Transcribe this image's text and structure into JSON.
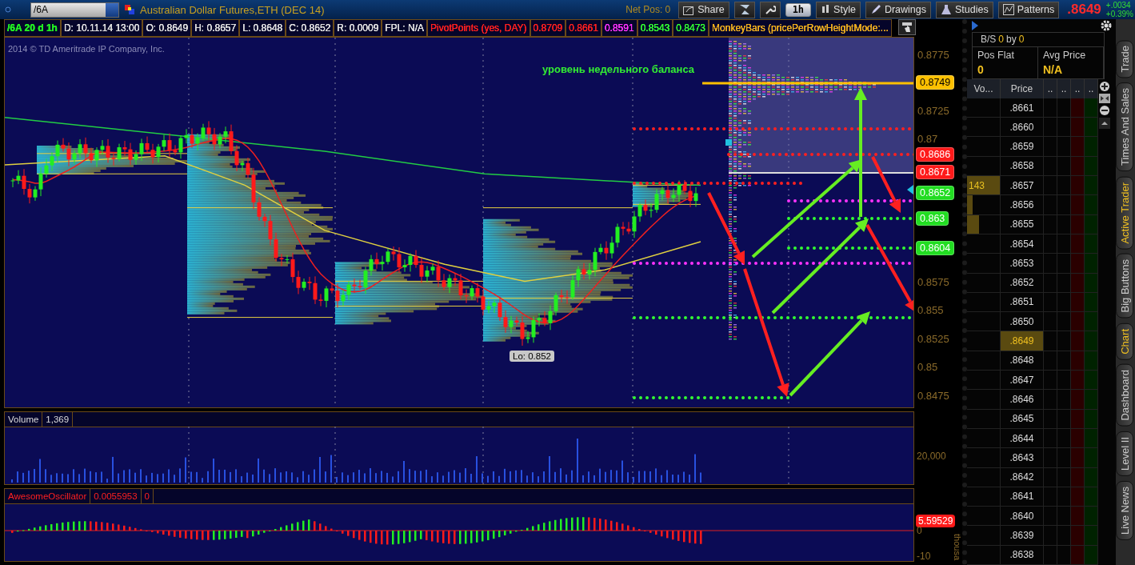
{
  "toolbar": {
    "symbol": "/6A",
    "title": "Australian Dollar Futures,ETH (DEC 14)",
    "net_position": "Net Pos: 0",
    "share": "Share",
    "period": "1h",
    "tools": [
      "Style",
      "Drawings",
      "Studies",
      "Patterns"
    ],
    "last": ".8649",
    "change": "+.0034",
    "change_pct": "+0.39%"
  },
  "info_bar": {
    "symbol": "/6A 20 d 1h",
    "fields": [
      "D: 10.11.14 13:00",
      "O: 0.8649",
      "H: 0.8657",
      "L: 0.8648",
      "C: 0.8652",
      "R: 0.0009",
      "FPL: N/A"
    ],
    "study": "PivotPoints (yes, DAY)",
    "study_values": [
      {
        "text": "0.8709",
        "kind": "resistance"
      },
      {
        "text": "0.8661",
        "kind": "resistance"
      },
      {
        "text": "0.8591",
        "kind": "pivot"
      },
      {
        "text": "0.8543",
        "kind": "support"
      },
      {
        "text": "0.8473",
        "kind": "support"
      }
    ],
    "overlay": "MonkeyBars (pricePerRowHeightMode:..."
  },
  "chart": {
    "copyright": "2014 © TD Ameritrade IP Company, Inc.",
    "annotation": "уровень недельного баланса",
    "low_label": "Lo: 0.852",
    "price_axis": [
      {
        "kind": "tick",
        "label": "0.8775"
      },
      {
        "kind": "badge",
        "label": "0.8749",
        "color": "#ffc000"
      },
      {
        "kind": "tick",
        "label": "0.8725"
      },
      {
        "kind": "tick",
        "label": "0.87"
      },
      {
        "kind": "badge",
        "label": "0.8686",
        "color": "#ff1a1a"
      },
      {
        "kind": "badge",
        "label": "0.8671",
        "color": "#ff1a1a"
      },
      {
        "kind": "badge",
        "label": "0.8652",
        "color": "#22dd22"
      },
      {
        "kind": "badge",
        "label": "0.863",
        "color": "#22dd22"
      },
      {
        "kind": "badge",
        "label": "0.8604",
        "color": "#22dd22"
      },
      {
        "kind": "tick",
        "label": "0.8575"
      },
      {
        "kind": "tick",
        "label": "0.855"
      },
      {
        "kind": "tick",
        "label": "0.8525"
      },
      {
        "kind": "tick",
        "label": "0.85"
      },
      {
        "kind": "tick",
        "label": "0.8475"
      }
    ]
  },
  "volume": {
    "label": "Volume",
    "value": "1,369",
    "axis": [
      "20,000"
    ]
  },
  "oscillator": {
    "label": "AwesomeOscillator",
    "values": [
      "0.0055953",
      "0"
    ],
    "badge": "5.59529",
    "axis": [
      "0",
      "-10"
    ],
    "unit": "thousa"
  },
  "trader": {
    "bs_label": "B/S",
    "buy": "0",
    "by": "by",
    "sell": "0",
    "position": [
      {
        "label": "Pos Flat",
        "value": "0"
      },
      {
        "label": "Avg Price",
        "value": "N/A"
      }
    ],
    "columns": [
      "Vo...",
      "Price",
      "..",
      "..",
      "..",
      ".."
    ],
    "rows": [
      {
        "price": ".8661",
        "selected": false
      },
      {
        "price": ".8660",
        "selected": false
      },
      {
        "price": ".8659",
        "selected": false
      },
      {
        "price": ".8658",
        "selected": false
      },
      {
        "price": ".8657",
        "selected": false,
        "volume": "143",
        "level": 1
      },
      {
        "price": ".8656",
        "selected": false,
        "level": 0.16
      },
      {
        "price": ".8655",
        "selected": false,
        "level": 0.37
      },
      {
        "price": ".8654",
        "selected": false
      },
      {
        "price": ".8653",
        "selected": false
      },
      {
        "price": ".8652",
        "selected": false
      },
      {
        "price": ".8651",
        "selected": false
      },
      {
        "price": ".8650",
        "selected": false
      },
      {
        "price": ".8649",
        "selected": true
      },
      {
        "price": ".8648",
        "selected": false
      },
      {
        "price": ".8647",
        "selected": false
      },
      {
        "price": ".8646",
        "selected": false
      },
      {
        "price": ".8645",
        "selected": false
      },
      {
        "price": ".8644",
        "selected": false
      },
      {
        "price": ".8643",
        "selected": false
      },
      {
        "price": ".8642",
        "selected": false
      },
      {
        "price": ".8641",
        "selected": false
      },
      {
        "price": ".8640",
        "selected": false
      },
      {
        "price": ".8639",
        "selected": false
      },
      {
        "price": ".8638",
        "selected": false
      }
    ]
  },
  "side_tabs": [
    {
      "label": "Trade",
      "selected": false
    },
    {
      "label": "Times And Sales",
      "selected": false
    },
    {
      "label": "Active Trader",
      "selected": true
    },
    {
      "label": "Big Buttons",
      "selected": false
    },
    {
      "label": "Chart",
      "selected": true
    },
    {
      "label": "Dashboard",
      "selected": false
    },
    {
      "label": "Level II",
      "selected": false
    },
    {
      "label": "Live News",
      "selected": false
    }
  ]
}
